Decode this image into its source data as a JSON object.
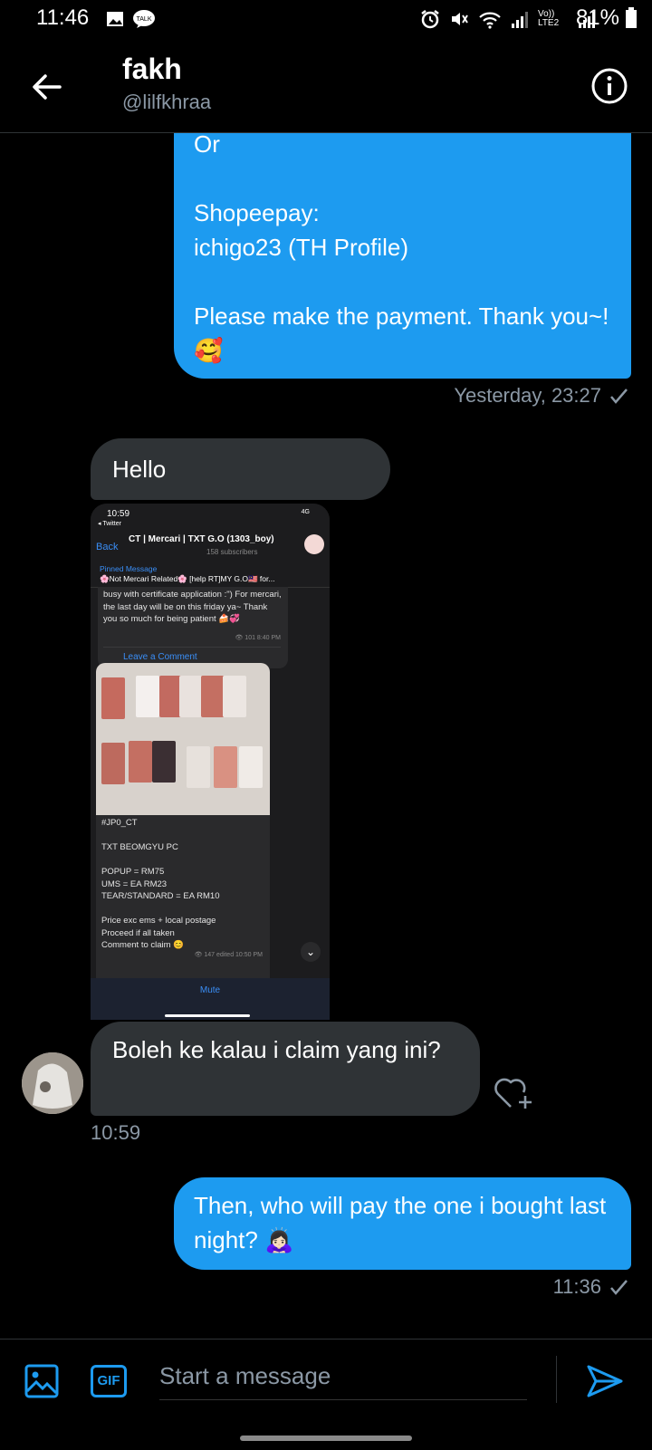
{
  "status_bar": {
    "time": "11:46",
    "battery": "81%",
    "net_label": "Vo)) LTE2"
  },
  "header": {
    "name": "fakh",
    "handle": "@lilfkhraa"
  },
  "messages": {
    "out1": {
      "text": "Or\n\nShopeepay:\nichigo23 (TH Profile)\n\nPlease make the payment. Thank you~! 🥰",
      "meta": "Yesterday, 23:27"
    },
    "in1": {
      "text": "Hello"
    },
    "in2": {
      "text": "Boleh ke kalau i claim yang ini?",
      "meta": "10:59"
    },
    "out2": {
      "text": "Then, who will pay the one i bought last night? 🙇🏻‍♀️",
      "meta": "11:36"
    }
  },
  "shared_image": {
    "status_time": "10:59",
    "status_back": "◂ Twitter",
    "status_net": "4G",
    "back": "Back",
    "channel": "CT | Mercari | TXT G.O (1303_boy)",
    "subscribers": "158 subscribers",
    "pinned_label": "Pinned Message",
    "pinned_text": "🌸Not Mercari Related🌸 [help RT]MY G.O🇲🇾 for...",
    "msg1_text": "busy with certificate application :\") For mercari, the last day will be on this friday ya~ Thank you so much for being patient 🍰💞",
    "msg1_meta": "👁 101 8:40 PM",
    "msg1_comment": "Leave a Comment",
    "post_text": "#JP0_CT\n\nTXT BEOMGYU PC\n\nPOPUP = RM75\nUMS = EA RM23\nTEAR/STANDARD = EA RM10\n\nPrice exc ems + local postage\nProceed if all taken\nComment to claim 😊",
    "post_meta": "👁 147 edited 10:50 PM",
    "mute": "Mute"
  },
  "composer": {
    "placeholder": "Start a message",
    "gif_label": "GIF"
  },
  "colors": {
    "accent": "#1d9bf0",
    "bubble_in": "#2f3336",
    "meta": "#8b98a5"
  }
}
